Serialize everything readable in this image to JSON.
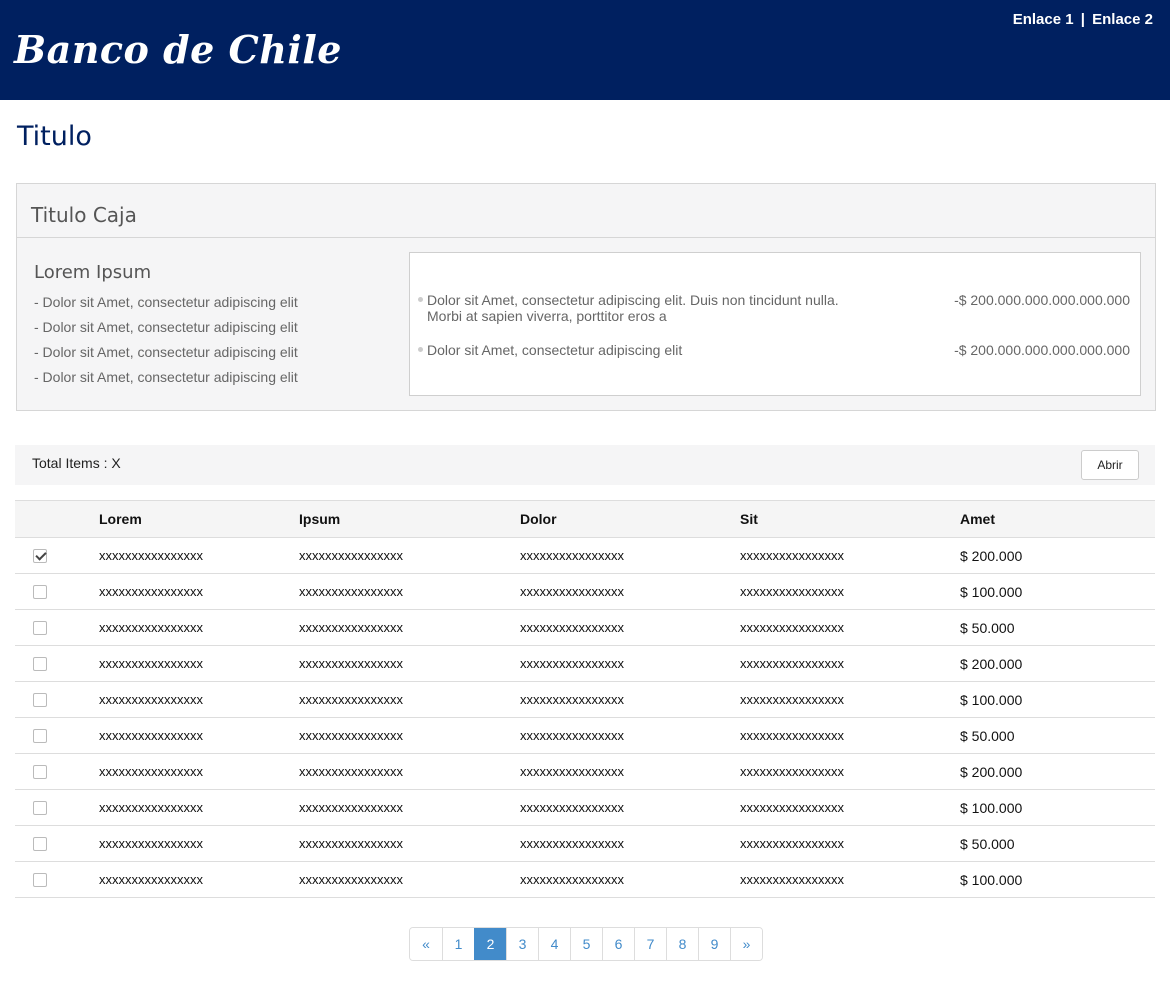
{
  "header": {
    "logo_text": "Banco de Chile",
    "links": [
      "Enlace 1",
      "Enlace 2"
    ],
    "separator": "|",
    "background": "#002060"
  },
  "page": {
    "title": "Titulo"
  },
  "box": {
    "title": "Titulo Caja",
    "left": {
      "heading": "Lorem Ipsum",
      "lines": [
        "- Dolor sit Amet, consectetur adipiscing elit",
        "- Dolor sit Amet, consectetur adipiscing elit",
        "- Dolor sit Amet, consectetur adipiscing elit",
        "- Dolor sit Amet, consectetur adipiscing elit"
      ]
    },
    "detail": [
      {
        "text": "Dolor sit Amet, consectetur adipiscing elit. Duis non tincidunt nulla. Morbi at sapien viverra, porttitor eros a",
        "amount": "-$ 200.000.000.000.000.000"
      },
      {
        "text": "Dolor sit Amet, consectetur adipiscing elit",
        "amount": "-$ 200.000.000.000.000.000"
      }
    ]
  },
  "toolbar": {
    "total_label": "Total Items : X",
    "open_button": "Abrir"
  },
  "table": {
    "columns": [
      "Lorem",
      "Ipsum",
      "Dolor",
      "Sit",
      "Amet"
    ],
    "rows": [
      {
        "checked": true,
        "cells": [
          "xxxxxxxxxxxxxxxx",
          "xxxxxxxxxxxxxxxx",
          "xxxxxxxxxxxxxxxx",
          "xxxxxxxxxxxxxxxx",
          "$ 200.000"
        ]
      },
      {
        "checked": false,
        "cells": [
          "xxxxxxxxxxxxxxxx",
          "xxxxxxxxxxxxxxxx",
          "xxxxxxxxxxxxxxxx",
          "xxxxxxxxxxxxxxxx",
          "$ 100.000"
        ]
      },
      {
        "checked": false,
        "cells": [
          "xxxxxxxxxxxxxxxx",
          "xxxxxxxxxxxxxxxx",
          "xxxxxxxxxxxxxxxx",
          "xxxxxxxxxxxxxxxx",
          "$ 50.000"
        ]
      },
      {
        "checked": false,
        "cells": [
          "xxxxxxxxxxxxxxxx",
          "xxxxxxxxxxxxxxxx",
          "xxxxxxxxxxxxxxxx",
          "xxxxxxxxxxxxxxxx",
          "$ 200.000"
        ]
      },
      {
        "checked": false,
        "cells": [
          "xxxxxxxxxxxxxxxx",
          "xxxxxxxxxxxxxxxx",
          "xxxxxxxxxxxxxxxx",
          "xxxxxxxxxxxxxxxx",
          "$ 100.000"
        ]
      },
      {
        "checked": false,
        "cells": [
          "xxxxxxxxxxxxxxxx",
          "xxxxxxxxxxxxxxxx",
          "xxxxxxxxxxxxxxxx",
          "xxxxxxxxxxxxxxxx",
          "$ 50.000"
        ]
      },
      {
        "checked": false,
        "cells": [
          "xxxxxxxxxxxxxxxx",
          "xxxxxxxxxxxxxxxx",
          "xxxxxxxxxxxxxxxx",
          "xxxxxxxxxxxxxxxx",
          "$ 200.000"
        ]
      },
      {
        "checked": false,
        "cells": [
          "xxxxxxxxxxxxxxxx",
          "xxxxxxxxxxxxxxxx",
          "xxxxxxxxxxxxxxxx",
          "xxxxxxxxxxxxxxxx",
          "$ 100.000"
        ]
      },
      {
        "checked": false,
        "cells": [
          "xxxxxxxxxxxxxxxx",
          "xxxxxxxxxxxxxxxx",
          "xxxxxxxxxxxxxxxx",
          "xxxxxxxxxxxxxxxx",
          "$ 50.000"
        ]
      },
      {
        "checked": false,
        "cells": [
          "xxxxxxxxxxxxxxxx",
          "xxxxxxxxxxxxxxxx",
          "xxxxxxxxxxxxxxxx",
          "xxxxxxxxxxxxxxxx",
          "$ 100.000"
        ]
      }
    ]
  },
  "pagination": {
    "prev": "«",
    "pages": [
      "1",
      "2",
      "3",
      "4",
      "5",
      "6",
      "7",
      "8",
      "9"
    ],
    "current": "2",
    "next": "»",
    "accent": "#428bca"
  }
}
